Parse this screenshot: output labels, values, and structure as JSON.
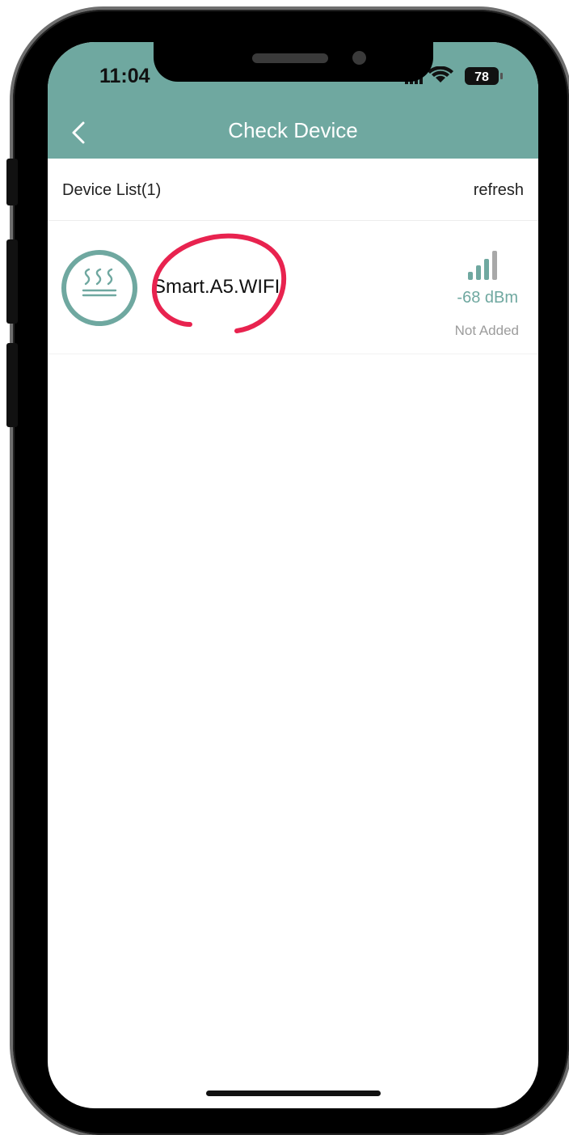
{
  "status_bar": {
    "time": "11:04",
    "battery": "78"
  },
  "nav": {
    "title": "Check Device",
    "color": "#6fa8a0"
  },
  "list": {
    "title": "Device List(1)",
    "refresh_label": "refresh"
  },
  "device": {
    "name": "Smart.A5.WIFI",
    "signal": "-68 dBm",
    "status": "Not Added",
    "icon": "heater-icon",
    "signal_icon": "signal-bars-icon"
  },
  "annotation_color": "#e8234f"
}
